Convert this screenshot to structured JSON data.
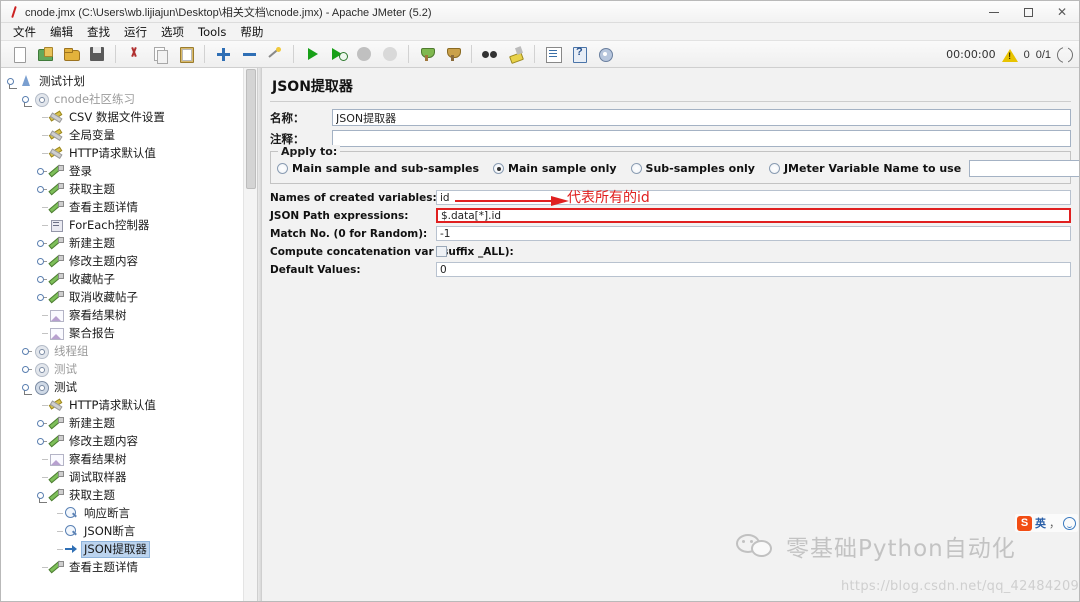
{
  "window": {
    "title": "cnode.jmx (C:\\Users\\wb.lijiajun\\Desktop\\相关文档\\cnode.jmx) - Apache JMeter (5.2)",
    "minimize_label": "Minimize",
    "maximize_label": "Maximize",
    "close_label": "Close"
  },
  "menubar": {
    "items": [
      {
        "label": "文件"
      },
      {
        "label": "编辑"
      },
      {
        "label": "查找"
      },
      {
        "label": "运行"
      },
      {
        "label": "选项"
      },
      {
        "label": "Tools"
      },
      {
        "label": "帮助"
      }
    ]
  },
  "toolbar": {
    "buttons": [
      {
        "name": "new-icon",
        "title": "新建"
      },
      {
        "name": "templates-icon",
        "title": "模板"
      },
      {
        "name": "open-icon",
        "title": "打开"
      },
      {
        "name": "save-icon",
        "title": "保存"
      },
      {
        "name": "cut-icon",
        "title": "剪切"
      },
      {
        "name": "copy-icon",
        "title": "复制"
      },
      {
        "name": "paste-icon",
        "title": "粘贴"
      },
      {
        "name": "expand-all-icon",
        "title": "展开全部"
      },
      {
        "name": "collapse-all-icon",
        "title": "收起全部"
      },
      {
        "name": "toggle-icon",
        "title": "启用/禁用"
      },
      {
        "name": "start-icon",
        "title": "启动"
      },
      {
        "name": "start-no-pauses-icon",
        "title": "无间隔启动"
      },
      {
        "name": "stop-icon",
        "title": "停止"
      },
      {
        "name": "shutdown-icon",
        "title": "关闭"
      },
      {
        "name": "clear-icon",
        "title": "清除"
      },
      {
        "name": "clear-all-icon",
        "title": "清除全部"
      },
      {
        "name": "search-icon",
        "title": "查找"
      },
      {
        "name": "reset-search-icon",
        "title": "重置查找"
      },
      {
        "name": "function-helper-icon",
        "title": "函数助手"
      },
      {
        "name": "help-icon",
        "title": "帮助"
      },
      {
        "name": "undo-redo-icon",
        "title": "选项"
      }
    ],
    "status": {
      "elapsed": "00:00:00",
      "warnings": "0",
      "threads": "0/1"
    }
  },
  "tree": {
    "nodes": [
      {
        "label": "测试计划",
        "indent": 0,
        "icon": "plan-icon",
        "handle": "expanded",
        "dim": false,
        "selected": false
      },
      {
        "label": "cnode社区练习",
        "indent": 1,
        "icon": "gear-icon",
        "handle": "expanded",
        "dim": true,
        "selected": false
      },
      {
        "label": "CSV 数据文件设置",
        "indent": 2,
        "icon": "config-icon",
        "handle": "leaf",
        "dim": false,
        "selected": false
      },
      {
        "label": "全局变量",
        "indent": 2,
        "icon": "config-icon",
        "handle": "leaf",
        "dim": false,
        "selected": false
      },
      {
        "label": "HTTP请求默认值",
        "indent": 2,
        "icon": "config-icon",
        "handle": "leaf",
        "dim": false,
        "selected": false
      },
      {
        "label": "登录",
        "indent": 2,
        "icon": "sampler-icon",
        "handle": "collapsed",
        "dim": false,
        "selected": false
      },
      {
        "label": "获取主题",
        "indent": 2,
        "icon": "sampler-icon",
        "handle": "collapsed",
        "dim": false,
        "selected": false
      },
      {
        "label": "查看主题详情",
        "indent": 2,
        "icon": "sampler-icon",
        "handle": "leaf",
        "dim": false,
        "selected": false
      },
      {
        "label": "ForEach控制器",
        "indent": 2,
        "icon": "controller-icon",
        "handle": "leaf",
        "dim": false,
        "selected": false
      },
      {
        "label": "新建主题",
        "indent": 2,
        "icon": "sampler-icon",
        "handle": "collapsed",
        "dim": false,
        "selected": false
      },
      {
        "label": "修改主题内容",
        "indent": 2,
        "icon": "sampler-icon",
        "handle": "collapsed",
        "dim": false,
        "selected": false
      },
      {
        "label": "收藏帖子",
        "indent": 2,
        "icon": "sampler-icon",
        "handle": "collapsed",
        "dim": false,
        "selected": false
      },
      {
        "label": "取消收藏帖子",
        "indent": 2,
        "icon": "sampler-icon",
        "handle": "collapsed",
        "dim": false,
        "selected": false
      },
      {
        "label": "察看结果树",
        "indent": 2,
        "icon": "listener-icon",
        "handle": "leaf",
        "dim": false,
        "selected": false
      },
      {
        "label": "聚合报告",
        "indent": 2,
        "icon": "listener-icon",
        "handle": "leaf",
        "dim": false,
        "selected": false
      },
      {
        "label": "线程组",
        "indent": 1,
        "icon": "gear-icon",
        "handle": "collapsed",
        "dim": true,
        "selected": false
      },
      {
        "label": "测试",
        "indent": 1,
        "icon": "gear-icon",
        "handle": "collapsed",
        "dim": true,
        "selected": false
      },
      {
        "label": "测试",
        "indent": 1,
        "icon": "gear-icon",
        "handle": "expanded",
        "dim": false,
        "selected": false
      },
      {
        "label": "HTTP请求默认值",
        "indent": 2,
        "icon": "config-icon",
        "handle": "leaf",
        "dim": false,
        "selected": false
      },
      {
        "label": "新建主题",
        "indent": 2,
        "icon": "sampler-icon",
        "handle": "collapsed",
        "dim": false,
        "selected": false
      },
      {
        "label": "修改主题内容",
        "indent": 2,
        "icon": "sampler-icon",
        "handle": "collapsed",
        "dim": false,
        "selected": false
      },
      {
        "label": "察看结果树",
        "indent": 2,
        "icon": "listener-icon",
        "handle": "leaf",
        "dim": false,
        "selected": false
      },
      {
        "label": "调试取样器",
        "indent": 2,
        "icon": "sampler-icon",
        "handle": "leaf",
        "dim": false,
        "selected": false
      },
      {
        "label": "获取主题",
        "indent": 2,
        "icon": "sampler-icon",
        "handle": "expanded",
        "dim": false,
        "selected": false
      },
      {
        "label": "响应断言",
        "indent": 3,
        "icon": "assertion-icon",
        "handle": "leaf",
        "dim": false,
        "selected": false
      },
      {
        "label": "JSON断言",
        "indent": 3,
        "icon": "assertion-icon",
        "handle": "leaf",
        "dim": false,
        "selected": false
      },
      {
        "label": "JSON提取器",
        "indent": 3,
        "icon": "extractor-icon",
        "handle": "leaf",
        "dim": false,
        "selected": true
      },
      {
        "label": "查看主题详情",
        "indent": 2,
        "icon": "sampler-icon",
        "handle": "leaf",
        "dim": false,
        "selected": false
      }
    ]
  },
  "panel": {
    "title": "JSON提取器",
    "name_label": "名称：",
    "name_value": "JSON提取器",
    "comment_label": "注释：",
    "comment_value": "",
    "apply_to": {
      "legend": "Apply to:",
      "options": [
        {
          "label": "Main sample and sub-samples",
          "selected": false
        },
        {
          "label": "Main sample only",
          "selected": true
        },
        {
          "label": "Sub-samples only",
          "selected": false
        },
        {
          "label": "JMeter Variable Name to use",
          "selected": false
        }
      ],
      "variable_value": ""
    },
    "fields": [
      {
        "label": "Names of created variables:",
        "value": "id",
        "type": "text",
        "highlight": false
      },
      {
        "label": "JSON Path expressions:",
        "value": "$.data[*].id",
        "type": "text",
        "highlight": true
      },
      {
        "label": "Match No. (0 for Random):",
        "value": "-1",
        "type": "text",
        "highlight": false
      },
      {
        "label": "Compute concatenation var (suffix _ALL):",
        "value": "",
        "type": "checkbox",
        "highlight": false
      },
      {
        "label": "Default Values:",
        "value": "0",
        "type": "text",
        "highlight": false
      }
    ],
    "annotation": {
      "text": "代表所有的id",
      "color": "#e02020"
    }
  },
  "watermark": {
    "brand": "零基础Python自动化",
    "url": "https://blog.csdn.net/qq_42484209"
  },
  "ime": {
    "logo": "S",
    "mode": "英",
    "separator": "，",
    "emoji_label": "emoji"
  }
}
